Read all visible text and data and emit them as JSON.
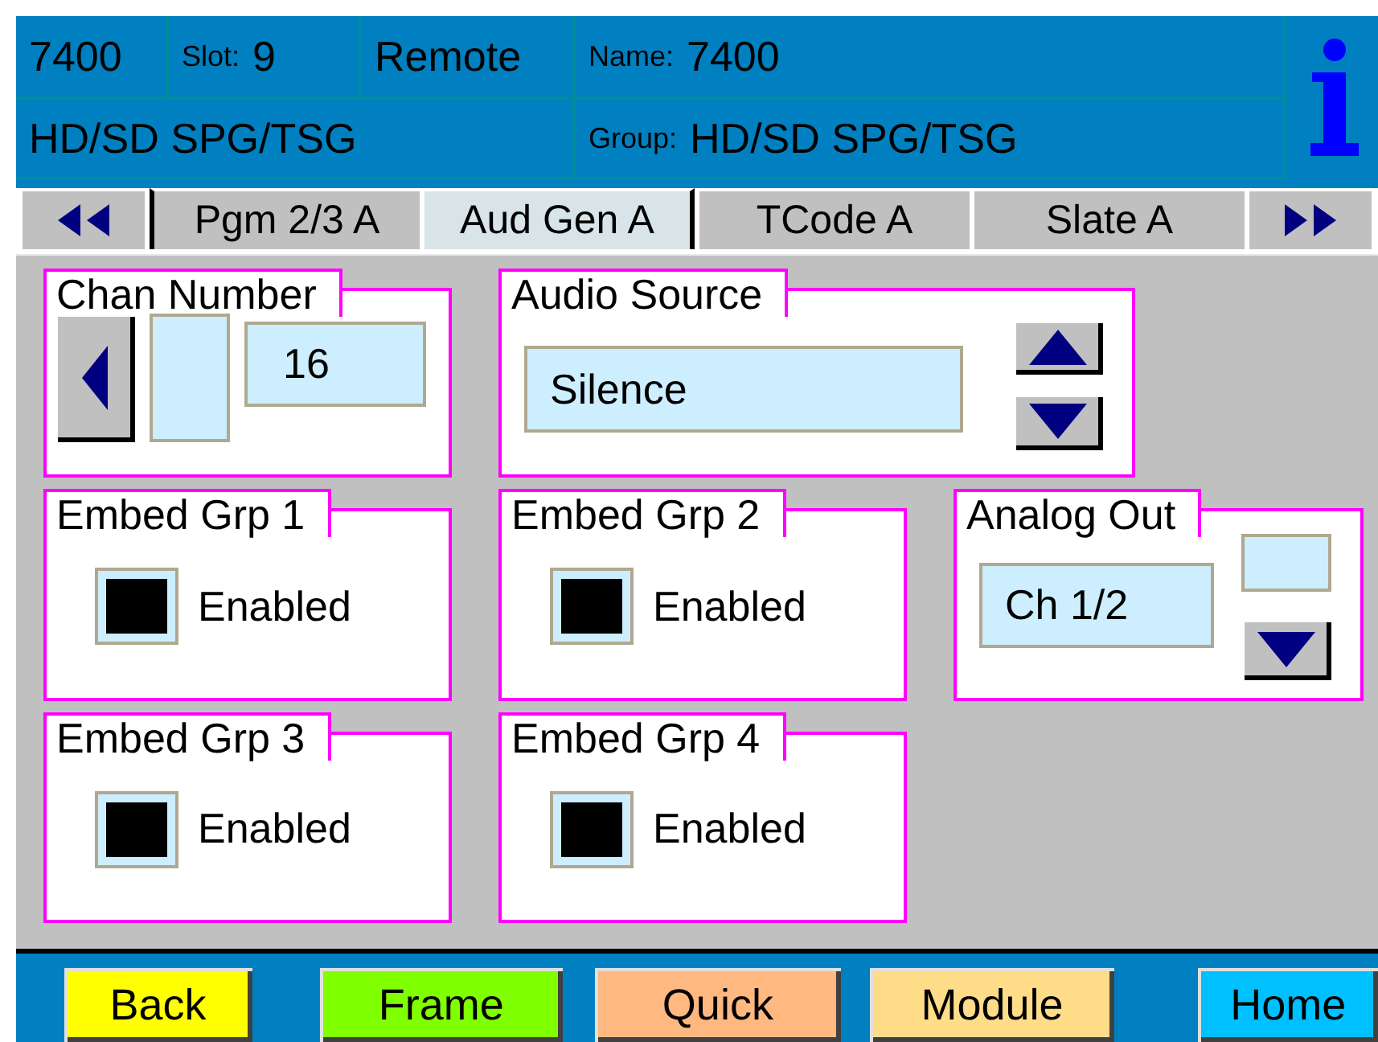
{
  "header": {
    "unit": "7400",
    "slot_label": "Slot:",
    "slot": "9",
    "mode": "Remote",
    "name_label": "Name:",
    "name": "7400",
    "model": "HD/SD SPG/TSG",
    "group_label": "Group:",
    "group": "HD/SD SPG/TSG"
  },
  "tabs": [
    {
      "label": "Pgm 2/3 A",
      "selected": false
    },
    {
      "label": "Aud Gen A",
      "selected": true
    },
    {
      "label": "TCode A",
      "selected": false
    },
    {
      "label": "Slate A",
      "selected": false
    }
  ],
  "panels": [
    {
      "kind": "number",
      "title": "Chan Number",
      "value": "16"
    },
    {
      "kind": "list",
      "title": "Audio Source",
      "value": "Silence"
    },
    {
      "kind": "check",
      "title": "Embed Grp 1",
      "label": "Enabled",
      "checked": true
    },
    {
      "kind": "check",
      "title": "Embed Grp 2",
      "label": "Enabled",
      "checked": true
    },
    {
      "kind": "dropdown",
      "title": "Analog Out",
      "value": "Ch 1/2"
    },
    {
      "kind": "check",
      "title": "Embed Grp 3",
      "label": "Enabled",
      "checked": true
    },
    {
      "kind": "check",
      "title": "Embed Grp 4",
      "label": "Enabled",
      "checked": true
    }
  ],
  "footer": [
    {
      "label": "Back",
      "color": "#ffff00"
    },
    {
      "label": "Frame",
      "color": "#80ff00"
    },
    {
      "label": "Quick",
      "color": "#ffb880"
    },
    {
      "label": "Module",
      "color": "#ffdc88"
    },
    {
      "label": "Home",
      "color": "#00c0ff"
    }
  ]
}
